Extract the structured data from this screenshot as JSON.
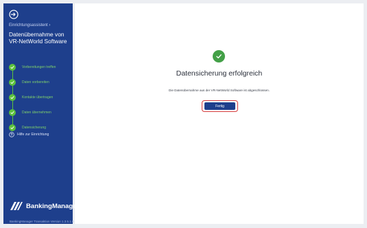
{
  "sidebar": {
    "assistant_label": "Einrichtungsassistent ›",
    "title": "Datenübernahme von VR-NetWorld Software",
    "steps": [
      {
        "label": "Vorbereitungen treffen",
        "status": "done"
      },
      {
        "label": "Daten vorbereiten",
        "status": "done"
      },
      {
        "label": "Kontakte übertragen",
        "status": "done"
      },
      {
        "label": "Daten übernehmen",
        "status": "done"
      },
      {
        "label": "Datensicherung",
        "status": "done"
      }
    ],
    "help_label": "Hilfe zur Einrichtung",
    "brand_name": "BankingManager",
    "version": "BankingManager Transaktion Version 1.3.5.1.0"
  },
  "main": {
    "headline": "Datensicherung erfolgreich",
    "message": "Die Datenübernahme aus der VR-NetWorld Software ist abgeschlossen.",
    "done_button_label": "Fertig"
  },
  "colors": {
    "sidebar_bg": "#1e3f8c",
    "step_done": "#5cc13d",
    "success": "#43a047",
    "button_bg": "#1e3f8c",
    "highlight": "#d63a3a"
  }
}
